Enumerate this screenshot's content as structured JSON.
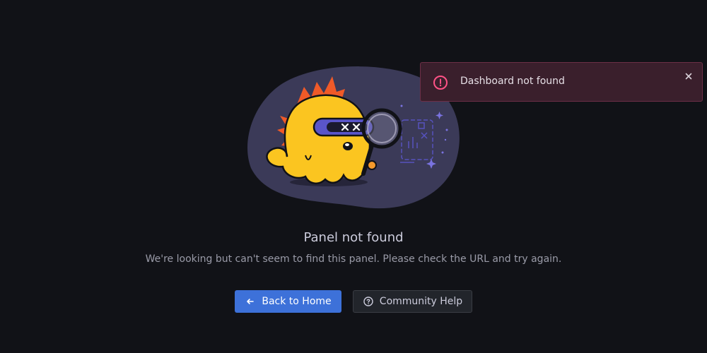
{
  "error": {
    "title": "Panel not found",
    "message": "We're looking but can't seem to find this panel. Please check the URL and try again."
  },
  "actions": {
    "home_label": "Back to Home",
    "home_icon": "arrow-left-icon",
    "help_label": "Community Help",
    "help_icon": "question-circle-icon"
  },
  "toast": {
    "text": "Dashboard not found",
    "icon": "exclamation-circle-icon",
    "close_icon": "close-icon"
  },
  "colors": {
    "background": "#111217",
    "primary": "#3d71d9",
    "toast_background": "#3a1f2c",
    "toast_accent": "#ff5286",
    "mascot": "#fbc520"
  }
}
